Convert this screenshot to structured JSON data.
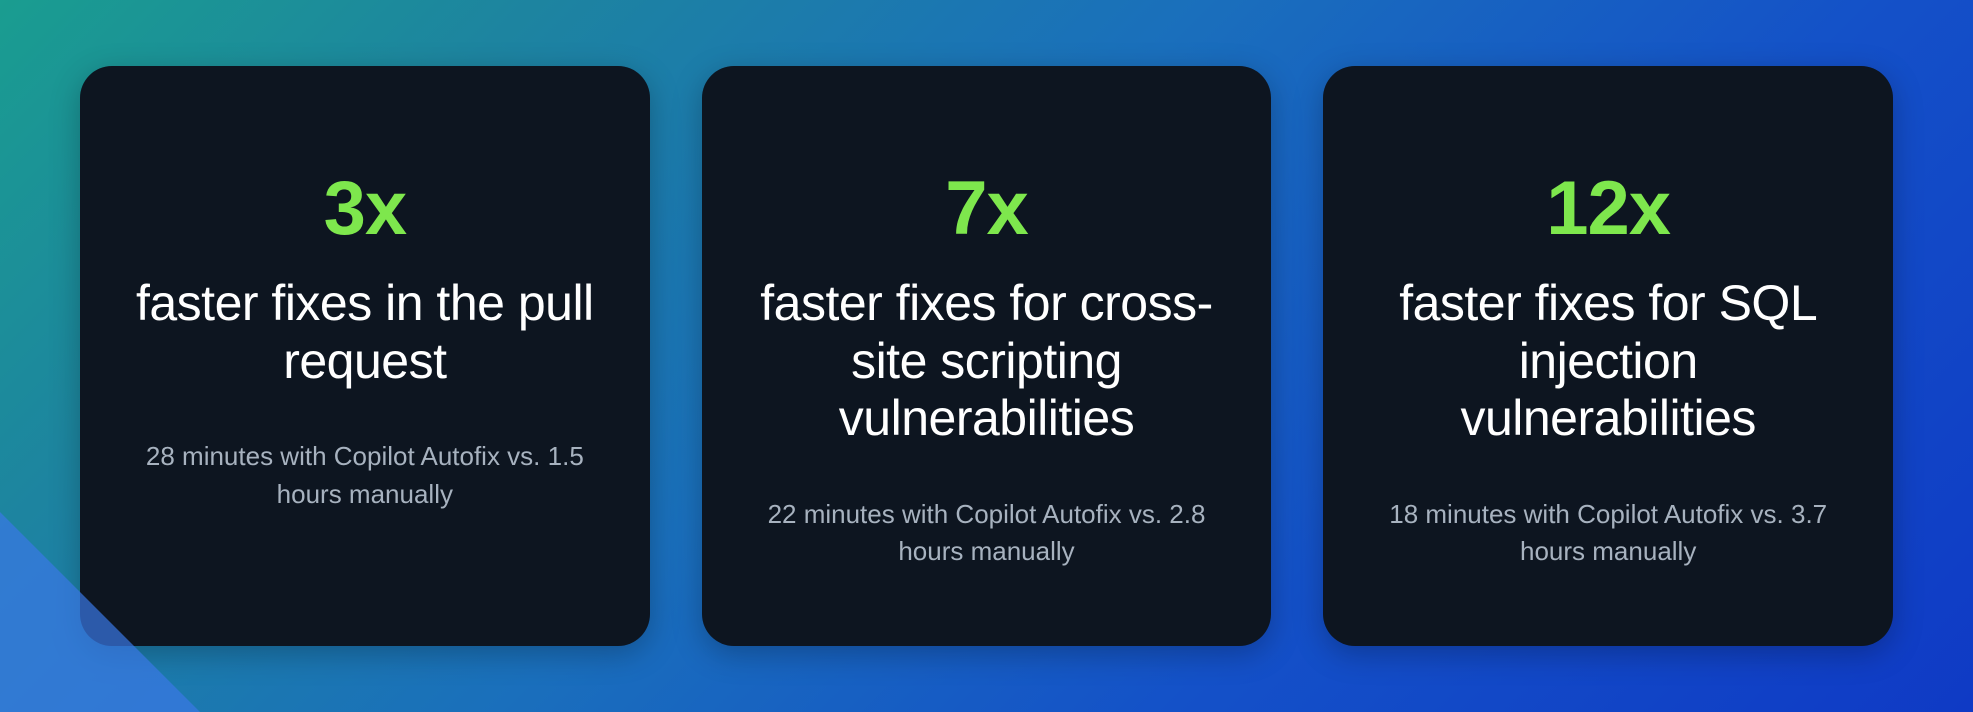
{
  "colors": {
    "accent": "#7ee74d",
    "card_bg": "#0d1520",
    "text_primary": "#ffffff",
    "text_secondary": "#a7b2bf"
  },
  "cards": [
    {
      "stat": "3x",
      "headline": "faster fixes in the pull request",
      "detail": "28 minutes with Copilot Autofix vs. 1.5 hours manually"
    },
    {
      "stat": "7x",
      "headline": "faster fixes for cross-site scripting vulnerabilities",
      "detail": "22 minutes with Copilot Autofix vs. 2.8 hours manually"
    },
    {
      "stat": "12x",
      "headline": "faster fixes for SQL injection vulnerabilities",
      "detail": "18 minutes with Copilot Autofix vs. 3.7 hours manually"
    }
  ]
}
